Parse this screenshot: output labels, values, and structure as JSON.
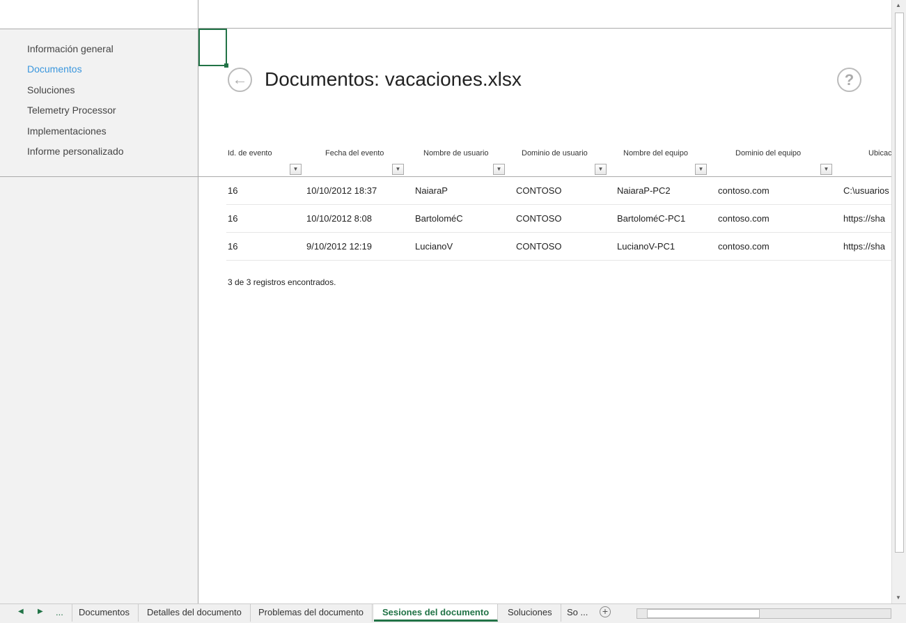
{
  "sidebar": {
    "items": [
      {
        "label": "Información general"
      },
      {
        "label": "Documentos",
        "active": true
      },
      {
        "label": "Soluciones"
      },
      {
        "label": "Telemetry Processor"
      },
      {
        "label": "Implementaciones"
      },
      {
        "label": "Informe personalizado"
      }
    ]
  },
  "page": {
    "title": "Documentos: vacaciones.xlsx",
    "back_icon": "←",
    "help_icon": "?"
  },
  "table": {
    "headers": [
      "Id. de evento",
      "Fecha del evento",
      "Nombre de usuario",
      "Dominio de usuario",
      "Nombre del equipo",
      "Dominio del equipo",
      "Ubicac"
    ],
    "rows": [
      [
        "16",
        "10/10/2012 18:37",
        "NaiaraP",
        "CONTOSO",
        "NaiaraP-PC2",
        "contoso.com",
        "C:\\usuarios"
      ],
      [
        "16",
        "10/10/2012 8:08",
        "BartoloméC",
        "CONTOSO",
        "BartoloméC-PC1",
        "contoso.com",
        "https://sha"
      ],
      [
        "16",
        "9/10/2012 12:19",
        "LucianoV",
        "CONTOSO",
        "LucianoV-PC1",
        "contoso.com",
        "https://sha"
      ]
    ],
    "count": "3 de 3 registros encontrados."
  },
  "tabs": {
    "items": [
      "Documentos",
      "Detalles del documento",
      "Problemas del documento",
      "Sesiones del documento",
      "Soluciones",
      "So ..."
    ],
    "active": 3,
    "more": "...",
    "add": "+"
  },
  "colors": {
    "accent": "#217346",
    "link": "#3a96dd"
  }
}
